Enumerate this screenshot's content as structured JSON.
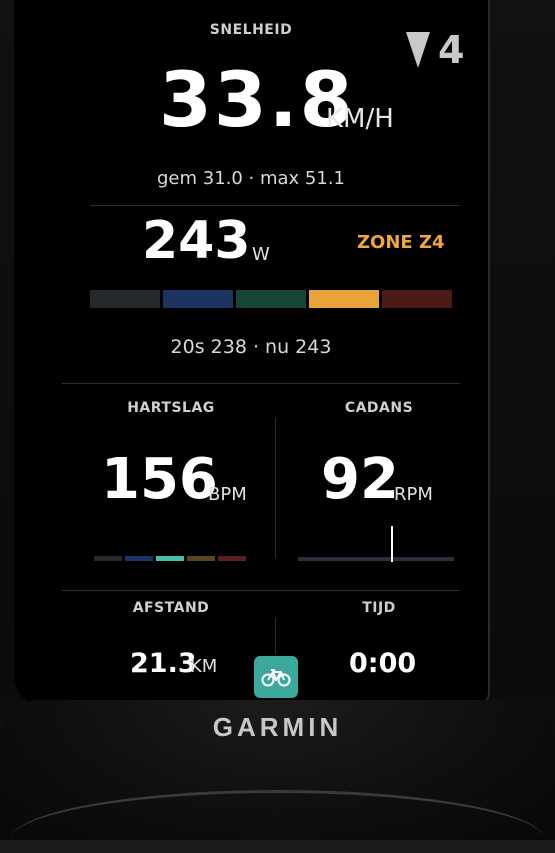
{
  "speed": {
    "label": "SNELHEID",
    "value": "33.8",
    "unit": "KM/H",
    "summary": "gem 31.0 · max 51.1",
    "climb_indicator": "4"
  },
  "power": {
    "value": "243",
    "unit": "W",
    "zone": "ZONE Z4",
    "summary": "20s 238 · nu 243",
    "zone_colors": [
      "#23292d",
      "#1e3460",
      "#164538",
      "#e8a33a",
      "#4b1c17"
    ],
    "active_zone": 4
  },
  "heart_rate": {
    "label": "HARTSLAG",
    "value": "156",
    "unit": "BPM",
    "zone_colors": [
      "#2a2a2a",
      "#1d3566",
      "#44c1ac",
      "#5a4420",
      "#5a2120"
    ],
    "active_zone": 3
  },
  "cadence": {
    "label": "CADANS",
    "value": "92",
    "unit": "RPM"
  },
  "distance": {
    "label": "AFSTAND",
    "value": "21.3",
    "unit": "KM"
  },
  "time": {
    "label": "TIJD",
    "value": "0:00"
  },
  "bike_button_icon": "bicycle-icon",
  "brand": "GARMIN",
  "colors": {
    "accent_zone": "#f0a640",
    "bike_button": "#3aa89a"
  }
}
